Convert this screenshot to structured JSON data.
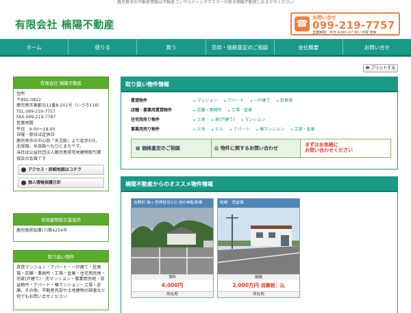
{
  "header": {
    "tagline": "鹿児島市の不動産情報は不動産コンサルティングマスターが居る楠陽不動産におまかせください",
    "logo": "有限会社 楠陽不動産",
    "contact_label": "お問い合せ",
    "phone": "099-219-7757",
    "hours": "営業時間　平日 9:00〜17:30 / 日祝 定休"
  },
  "nav": [
    "ホーム",
    "借りる",
    "買う",
    "売却・価格査定のご相談",
    "会社概要",
    "お問い合せ"
  ],
  "print_label": "プリントする",
  "sidebar": {
    "company_title": "有限会社 楠陽不動産",
    "company_lines": [
      "住所",
      "〒892-0822",
      "鹿児島市東郡元11番8-201号（いづろ118）",
      "TEL.099-219-7757",
      "FAX.099-219-7787",
      "営業時間",
      "平日　9:00〜18:00",
      "日曜・祭日は定休日",
      "鹿児島市の中心街「天文館」より徒歩5分。",
      "北埠頭、水族館へもひとまちです。",
      "当社は公益社団法人鹿児島県宅地建物取引業",
      "協会の会員です"
    ],
    "btn_access": "アクセス・詳細地図はコチラ",
    "btn_privacy": "個人情報保護方針",
    "license_title": "宅地建物取引業免許",
    "license_text": "鹿児島県知事(7)第4254号",
    "handling_title": "取り扱い物件",
    "handling_text": "賃貸マンション・アパート・一戸建て・駐車場・店舗・事務所・工場・倉庫・住宅用売地・売家(戸建て)・売マンション・事業用売地・収益物件・アパート・棟マンション・工場・倉庫、その他、不動産売却や土地建物の調査など何でもお問い合せください"
  },
  "properties": {
    "title": "取り扱い物件情報",
    "rows": [
      {
        "k": "賃貸物件",
        "v": [
          "マンション",
          "アパート",
          "一戸建て",
          "駐車場"
        ]
      },
      {
        "k": "店舗・事業用賃貸物件",
        "v": [
          "店舗・事務所",
          "工場・倉庫"
        ]
      },
      {
        "k": "住宅用売り物件",
        "v": [
          "土地",
          "家(戸建て)",
          "マンション"
        ]
      },
      {
        "k": "事業用売り物件",
        "v": [
          "土地",
          "ビル",
          "アパート",
          "棟マンション",
          "工場・倉庫"
        ]
      }
    ],
    "banner1": "価格査定のご相談",
    "banner2": "物件に関するお問い合わせ",
    "banner3a": "まずはお気軽に",
    "banner3b": "お問い合わせください"
  },
  "recommend": {
    "title": "楠陽不動産からのオススメ物件情報",
    "cards": [
      {
        "title": "吉野町 後ヶ宮停徒歩1分 池の神駐車場",
        "label1": "賃料",
        "value": "4,000円",
        "label2": "所在地"
      },
      {
        "title": "枕崎　売倉庫",
        "label1": "価格",
        "value": "2,000万円",
        "tax": "消費税：込",
        "label2": "所在地"
      }
    ]
  }
}
